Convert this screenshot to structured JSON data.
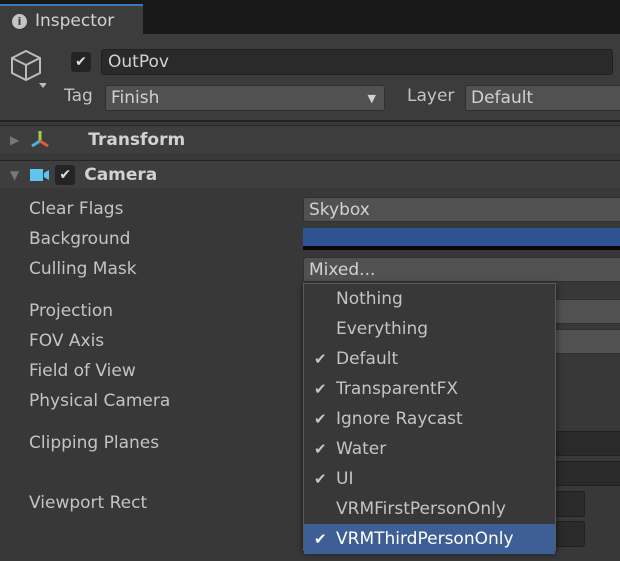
{
  "tab": {
    "title": "Inspector",
    "icon": "info-icon"
  },
  "gameobject": {
    "active": true,
    "name": "OutPov",
    "tag_label": "Tag",
    "tag": "Finish",
    "layer_label": "Layer",
    "layer": "Default"
  },
  "components": [
    {
      "name": "Transform",
      "expanded": false
    },
    {
      "name": "Camera",
      "expanded": true,
      "enabled": true
    }
  ],
  "camera": {
    "clear_flags_label": "Clear Flags",
    "clear_flags": "Skybox",
    "background_label": "Background",
    "background_color": "#2f5290",
    "culling_mask_label": "Culling Mask",
    "culling_mask": "Mixed...",
    "projection_label": "Projection",
    "fov_axis_label": "FOV Axis",
    "fov_label": "Field of View",
    "physical_label": "Physical Camera",
    "clipping_label": "Clipping Planes",
    "viewport_label": "Viewport Rect"
  },
  "popup": {
    "items": [
      {
        "label": "Nothing",
        "checked": false
      },
      {
        "label": "Everything",
        "checked": false
      },
      {
        "label": "Default",
        "checked": true
      },
      {
        "label": "TransparentFX",
        "checked": true
      },
      {
        "label": "Ignore Raycast",
        "checked": true
      },
      {
        "label": "Water",
        "checked": true
      },
      {
        "label": "UI",
        "checked": true
      },
      {
        "label": "VRMFirstPersonOnly",
        "checked": false
      },
      {
        "label": "VRMThirdPersonOnly",
        "checked": true,
        "highlighted": true
      }
    ],
    "check_glyph": "✔"
  }
}
